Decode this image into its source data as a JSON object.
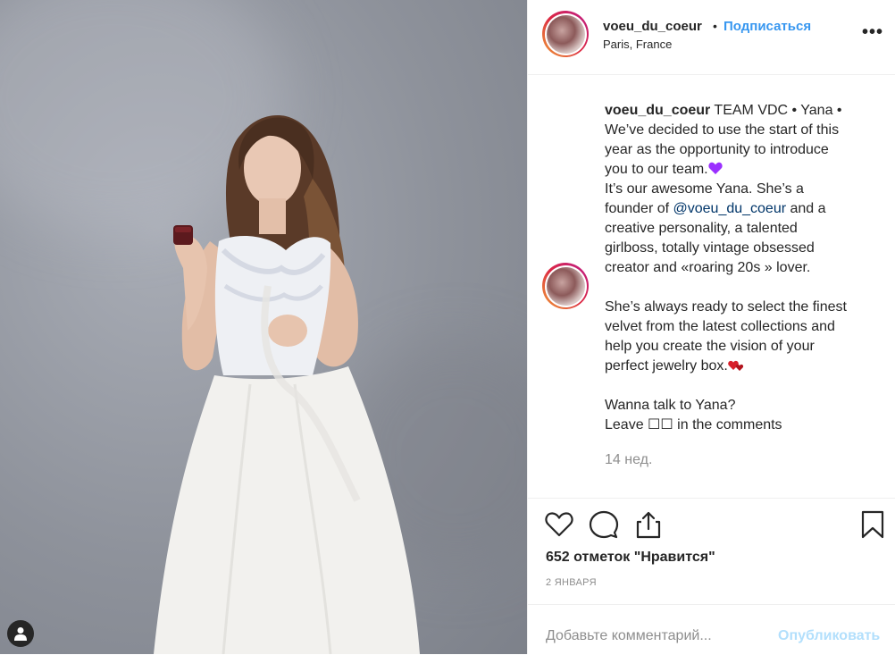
{
  "post": {
    "username": "voeu_du_coeur",
    "follow_label": "Подписаться",
    "location": "Paris, France",
    "more_label": "•••",
    "caption_line1": "voeu_du_coeur",
    "caption_p1": " TEAM VDC • Yana •\nWe’ve decided to use the start of this\nyear as the opportunity to introduce\nyou to our team.",
    "caption_p2": "\nIt’s our awesome Yana. She’s a\nfounder of ",
    "mention": "@voeu_du_coeur",
    "caption_p3": " and a\ncreative personality, a talented\ngirlboss, totally vintage obsessed\ncreator and «roaring 20s » lover.\n\nShe’s always ready to select the finest\nvelvet from the latest collections and\nhelp you create the vision of your\nperfect jewelry box.",
    "caption_p4": "\n\nWanna talk to Yana?\nLeave ☐☐ in the comments",
    "time_ago": "14 нед.",
    "likes": "652 отметок \"Нравится\"",
    "date": "2 ЯНВАРЯ",
    "comment_placeholder": "Добавьте комментарий...",
    "publish_label": "Опубликовать",
    "heart_emoji_color": "#9b30ff",
    "heart_red_color": "#d81f2a"
  },
  "icons": [
    "heart-icon",
    "comment-icon",
    "share-icon",
    "bookmark-icon",
    "user-icon",
    "more-icon"
  ]
}
